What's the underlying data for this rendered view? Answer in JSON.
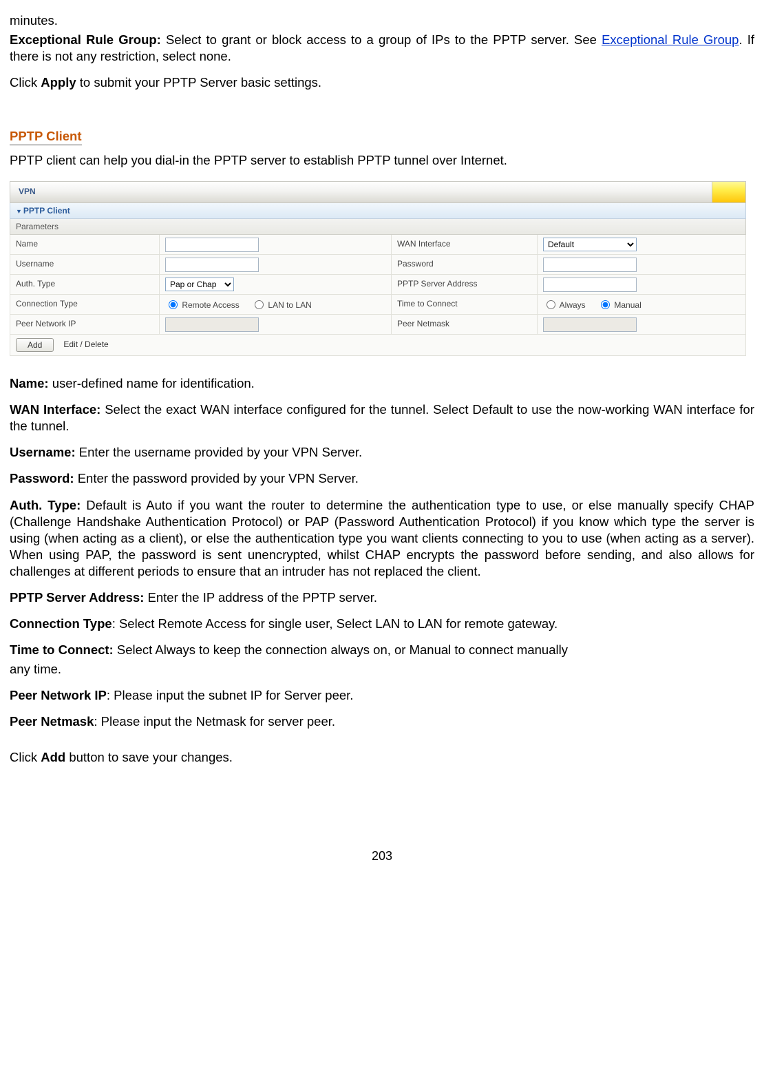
{
  "intro": {
    "minutes": "minutes.",
    "ex_rule_bold": "Exceptional Rule Group:",
    "ex_rule_text1": " Select to grant or block access to a group of IPs to the PPTP server. See ",
    "ex_rule_link": "Exceptional Rule Group",
    "ex_rule_text2": ". If there is not any restriction, select none.",
    "apply1": "Click ",
    "apply_bold": "Apply",
    "apply2": " to submit your PPTP Server basic settings."
  },
  "section_title": "PPTP Client",
  "section_subtitle": "PPTP client can help you dial-in the PPTP server to establish PPTP tunnel over Internet.",
  "vpn": {
    "title": "VPN",
    "section": "PPTP Client",
    "params": "Parameters",
    "rows": {
      "name_label": "Name",
      "wan_label": "WAN Interface",
      "wan_value": "Default",
      "user_label": "Username",
      "pass_label": "Password",
      "auth_label": "Auth. Type",
      "auth_value": "Pap or Chap",
      "server_label": "PPTP Server Address",
      "conn_label": "Connection Type",
      "conn_opt1": "Remote Access",
      "conn_opt2": "LAN to LAN",
      "time_label": "Time to Connect",
      "time_opt1": "Always",
      "time_opt2": "Manual",
      "peer_ip_label": "Peer Network IP",
      "peer_mask_label": "Peer Netmask"
    },
    "buttons": {
      "add": "Add",
      "edit": "Edit / Delete"
    }
  },
  "desc": {
    "name_b": "Name:",
    "name_t": " user-defined name for identification.",
    "wan_b": "WAN Interface:",
    "wan_t": " Select the exact WAN interface configured for the tunnel. Select Default to use the now-working WAN interface for the tunnel.",
    "user_b": "Username:",
    "user_t": " Enter the username provided by your VPN Server.",
    "pass_b": "Password:",
    "pass_t": " Enter the password provided by your VPN Server.",
    "auth_b": "Auth. Type:",
    "auth_t": " Default is Auto if you want the router to determine the authentication type to use, or else manually specify CHAP (Challenge Handshake Authentication Protocol) or PAP (Password Authentication Protocol) if you know which type the server is using (when acting as a client), or else the authentication type you want clients connecting to you to use (when acting as a server). When using PAP, the password is sent unencrypted, whilst CHAP encrypts the password before sending, and also allows for challenges at different periods to ensure that an intruder has not replaced the client.",
    "srv_b": "PPTP Server Address:",
    "srv_t": " Enter the IP address of the PPTP server.",
    "conn_b": "Connection Type",
    "conn_t": ": Select Remote Access for single user, Select LAN to LAN for remote gateway.",
    "time_b": "Time to Connect:",
    "time_t": " Select Always to keep the connection always on, or Manual to connect manually",
    "time_t2": "any time.",
    "pip_b": "Peer Network IP",
    "pip_t": ": Please input the subnet IP for Server peer.",
    "pmask_b": "Peer Netmask",
    "pmask_t": ": Please input the Netmask for server peer.",
    "add1": "Click ",
    "add_b": "Add",
    "add2": " button to save your changes."
  },
  "page_number": "203"
}
